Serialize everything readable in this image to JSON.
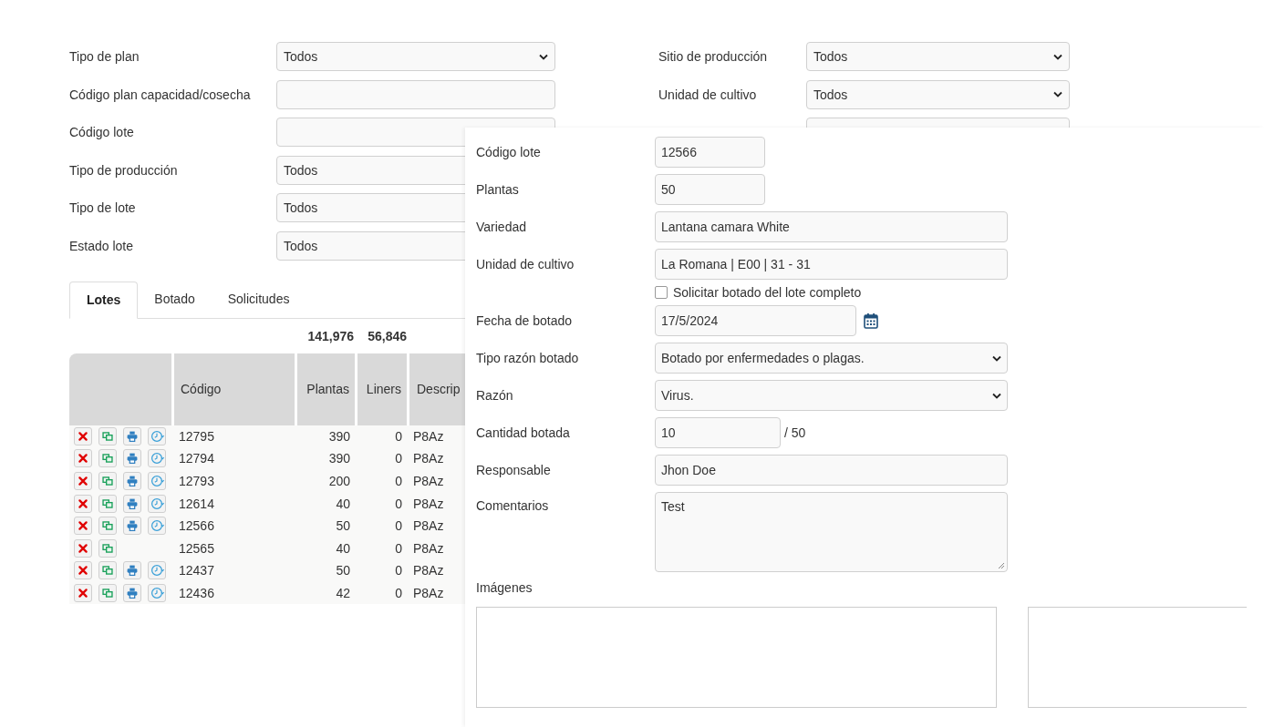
{
  "filters_left": [
    {
      "label": "Tipo de plan",
      "kind": "select",
      "value": "Todos",
      "chevron": true
    },
    {
      "label": "Código plan capacidad/cosecha",
      "kind": "text"
    },
    {
      "label": "Código lote",
      "kind": "text"
    },
    {
      "label": "Tipo de producción",
      "kind": "select",
      "value": "Todos",
      "chevron": false
    },
    {
      "label": "Tipo de lote",
      "kind": "select",
      "value": "Todos",
      "chevron": false
    },
    {
      "label": "Estado lote",
      "kind": "select",
      "value": "Todos",
      "chevron": false
    }
  ],
  "filters_right": [
    {
      "label": "Sitio de producción",
      "kind": "select",
      "value": "Todos",
      "chevron": true
    },
    {
      "label": "Unidad de cultivo",
      "kind": "select",
      "value": "Todos",
      "chevron": true
    },
    {
      "kind": "select",
      "chevron": false
    }
  ],
  "tabs": [
    {
      "label": "Lotes",
      "selected": true
    },
    {
      "label": "Botado",
      "selected": false
    },
    {
      "label": "Solicitudes",
      "selected": false
    }
  ],
  "table": {
    "totals": [
      "141,976",
      "56,846"
    ],
    "columns": [
      "Código",
      "Plantas",
      "Liners",
      "Descrip"
    ],
    "rows": [
      {
        "actions": [
          {
            "kind": "delete"
          },
          {
            "kind": "copy"
          },
          {
            "kind": "print"
          },
          {
            "kind": "history"
          }
        ],
        "cells": [
          "12795",
          "390",
          "0",
          "P8Az"
        ]
      },
      {
        "actions": [
          {
            "kind": "delete"
          },
          {
            "kind": "copy"
          },
          {
            "kind": "print"
          },
          {
            "kind": "history"
          }
        ],
        "cells": [
          "12794",
          "390",
          "0",
          "P8Az"
        ]
      },
      {
        "actions": [
          {
            "kind": "delete"
          },
          {
            "kind": "copy"
          },
          {
            "kind": "print"
          },
          {
            "kind": "history"
          }
        ],
        "cells": [
          "12793",
          "200",
          "0",
          "P8Az"
        ]
      },
      {
        "actions": [
          {
            "kind": "delete"
          },
          {
            "kind": "copy"
          },
          {
            "kind": "print"
          },
          {
            "kind": "history"
          }
        ],
        "cells": [
          "12614",
          "40",
          "0",
          "P8Az"
        ]
      },
      {
        "actions": [
          {
            "kind": "delete"
          },
          {
            "kind": "copy"
          },
          {
            "kind": "print"
          },
          {
            "kind": "history"
          }
        ],
        "cells": [
          "12566",
          "50",
          "0",
          "P8Az"
        ]
      },
      {
        "actions": [
          {
            "kind": "delete"
          },
          {
            "kind": "copy"
          }
        ],
        "cells": [
          "12565",
          "40",
          "0",
          "P8Az"
        ]
      },
      {
        "actions": [
          {
            "kind": "delete"
          },
          {
            "kind": "copy"
          },
          {
            "kind": "print"
          },
          {
            "kind": "history"
          }
        ],
        "cells": [
          "12437",
          "50",
          "0",
          "P8Az"
        ]
      },
      {
        "actions": [
          {
            "kind": "delete"
          },
          {
            "kind": "copy"
          },
          {
            "kind": "print"
          },
          {
            "kind": "history"
          }
        ],
        "cells": [
          "12436",
          "42",
          "0",
          "P8Az"
        ]
      }
    ]
  },
  "panel": {
    "fields": [
      {
        "kind": "short",
        "label": "Código lote",
        "value": "12566"
      },
      {
        "kind": "short",
        "label": "Plantas",
        "value": "50"
      },
      {
        "kind": "text",
        "label": "Variedad",
        "value": "Lantana camara White"
      },
      {
        "kind": "text",
        "label": "Unidad de cultivo",
        "value": "La Romana | E00 | 31 - 31"
      },
      {
        "kind": "checkbox",
        "label": "Solicitar botado del lote completo",
        "checked": false
      },
      {
        "kind": "date",
        "label": "Fecha de botado",
        "value": "17/5/2024"
      },
      {
        "kind": "select",
        "label": "Tipo razón botado",
        "value": "Botado por enfermedades o plagas."
      },
      {
        "kind": "select",
        "label": "Razón",
        "value": "Virus."
      },
      {
        "kind": "quantity",
        "label": "Cantidad botada",
        "value": "10",
        "suffix": "/ 50"
      },
      {
        "kind": "text",
        "label": "Responsable",
        "value": "Jhon Doe"
      },
      {
        "kind": "textarea",
        "label": "Comentarios",
        "value": "Test"
      }
    ],
    "images_label": "Imágenes"
  }
}
